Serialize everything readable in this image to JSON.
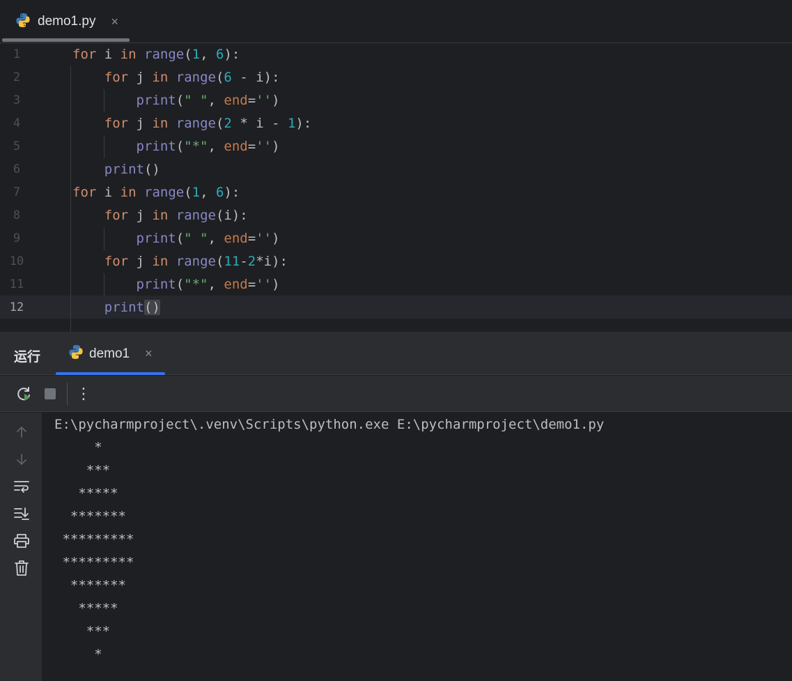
{
  "editor_tab": {
    "filename": "demo1.py",
    "close_glyph": "×",
    "icon": "python-file-icon"
  },
  "code": {
    "line_numbers": [
      "1",
      "2",
      "3",
      "4",
      "5",
      "6",
      "7",
      "8",
      "9",
      "10",
      "11",
      "12"
    ],
    "current_line": "12"
  },
  "run_panel": {
    "title": "运行",
    "tab_label": "demo1",
    "tab_close_glyph": "×",
    "accent_color": "#3574f0",
    "toolbar": {
      "rerun_icon": "rerun-icon",
      "stop_icon": "stop-icon",
      "more_icon": "more-options-icon",
      "more_glyph": "⋮"
    },
    "side_icons": [
      "arrow-up-icon",
      "arrow-down-icon",
      "soft-wrap-icon",
      "scroll-to-end-icon",
      "print-icon",
      "trash-icon"
    ],
    "output": [
      "E:\\pycharmproject\\.venv\\Scripts\\python.exe E:\\pycharmproject\\demo1.py",
      "     *",
      "    ***",
      "   *****",
      "  *******",
      " *********",
      " *********",
      "  *******",
      "   *****",
      "    ***",
      "     *"
    ]
  }
}
